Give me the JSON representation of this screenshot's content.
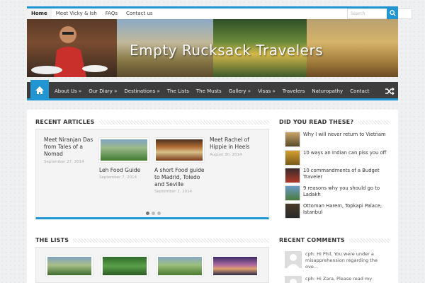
{
  "topnav": {
    "items": [
      "Home",
      "Meet Vicky & Ish",
      "FAQs",
      "Contact us"
    ],
    "search_placeholder": "Search"
  },
  "banner": {
    "title": "Empty Rucksack Travelers"
  },
  "mainnav": {
    "items": [
      "About Us »",
      "Our Diary »",
      "Destinations »",
      "The Lists",
      "The Musts",
      "Gallery »",
      "Visas »",
      "Travelers",
      "Naturopathy",
      "Contact"
    ]
  },
  "recent": {
    "title": "RECENT ARTICLES",
    "articles": [
      {
        "title": "Meet Niranjan Das from Tales of a Nomad",
        "date": "September 27, 2014"
      },
      {
        "title": "Leh Food Guide",
        "date": "September 7, 2014"
      },
      {
        "title": "A short Food guide to Madrid, Toledo and Seville",
        "date": "September 2, 2014"
      },
      {
        "title": "Meet Rachel of Hippie in Heels",
        "date": "August 30, 2014"
      }
    ]
  },
  "lists": {
    "title": "THE LISTS"
  },
  "sidebar": {
    "title": "DID YOU READ THESE?",
    "items": [
      "Why I will never return to Vietnam",
      "10 ways an Indian can piss you off",
      "10 commandments of a Budget Traveler",
      "9 reasons why you should go to Ladakh",
      "Ottoman Harem, Topkapi Palace, Istanbul"
    ]
  },
  "comments": {
    "title": "RECENT COMMENTS",
    "items": [
      "cph: Hi Phil, You were under a misapprehension regarding the ove...",
      "cph: Hi Zara, Please read my"
    ]
  },
  "colors": {
    "accent": "#2196d3",
    "nav_bg": "#3d3d3d"
  }
}
